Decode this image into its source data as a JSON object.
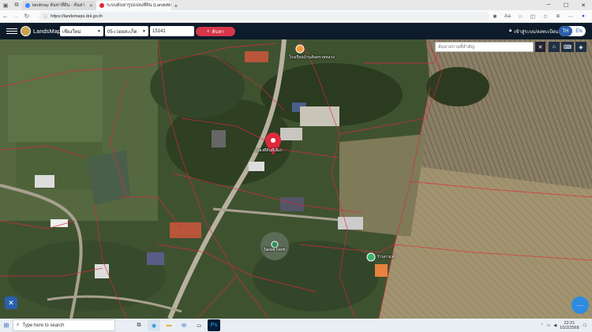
{
  "browser": {
    "tabs": [
      {
        "title": "landmay ค้นหาที่ดิน - ค้นหา",
        "active": false
      },
      {
        "title": "ระบบค้นหารูปแปลงที่ดิน (LandsMaps)",
        "active": true
      }
    ],
    "url": "https://landsmaps.dol.go.th"
  },
  "app": {
    "logo_text": "LandsMaps",
    "province": "เชียงใหม่",
    "district": "05-เวอยสะเก็ด",
    "parcel_number": "15141",
    "search_label": "ค้นหา",
    "login_label": "เข้าสู่ระบบ/ลงทะเบียน",
    "lang_th": "TH",
    "lang_en": "EN"
  },
  "map": {
    "search_placeholder": "ค้นหาสถานที่สำคัญ",
    "selected_parcel_label": "แปลงที่ดินที่เลือก",
    "poi_top_label": "โรงเรียนบ้านสันทรายหลวง",
    "poi_farm_label": "Taewa Farm",
    "poi_right_label": "ร้านกาแฟ",
    "accent_colors": {
      "header": "#0d1b2a",
      "search_button": "#d6364a",
      "pin": "#e0283c",
      "fab": "#2d8be0"
    }
  },
  "taskbar": {
    "search_placeholder": "Type here to search",
    "time": "22:21",
    "date": "10/2/2568"
  }
}
